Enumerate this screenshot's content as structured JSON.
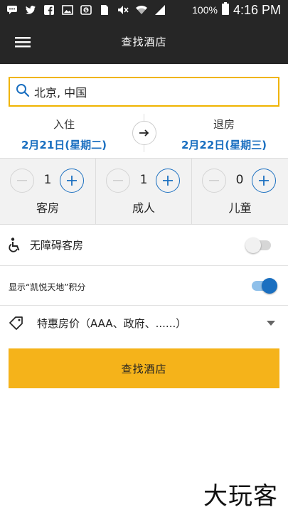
{
  "status_bar": {
    "battery_percent": "100%",
    "time": "4:16 PM",
    "icons": [
      "chat-icon",
      "twitter-icon",
      "facebook-icon",
      "image-icon",
      "dollar-icon",
      "sim-icon",
      "mute-icon",
      "wifi-icon",
      "signal-icon",
      "battery-icon"
    ]
  },
  "header": {
    "title": "查找酒店",
    "menu_icon": "hamburger-menu-icon"
  },
  "search": {
    "value": "北京, 中国",
    "icon": "search-icon",
    "border_color": "#f0b400"
  },
  "dates": {
    "checkin_label": "入住",
    "checkin_value": "2月21日(星期二)",
    "checkout_label": "退房",
    "checkout_value": "2月22日(星期三)",
    "swap_icon": "arrow-right-icon"
  },
  "counters": [
    {
      "label": "客房",
      "value": "1"
    },
    {
      "label": "成人",
      "value": "1"
    },
    {
      "label": "儿童",
      "value": "0"
    }
  ],
  "options": {
    "accessible_label": "无障碍客房",
    "accessible_on": false,
    "points_label": "显示“凯悦天地”积分",
    "points_on": true,
    "rate_label": "特惠房价（AAA、政府、......）"
  },
  "submit": {
    "label": "查找酒店",
    "color": "#f5b31a"
  },
  "watermark": "大玩客",
  "colors": {
    "accent_blue": "#1a6fc0",
    "bar_dark": "#262626"
  }
}
